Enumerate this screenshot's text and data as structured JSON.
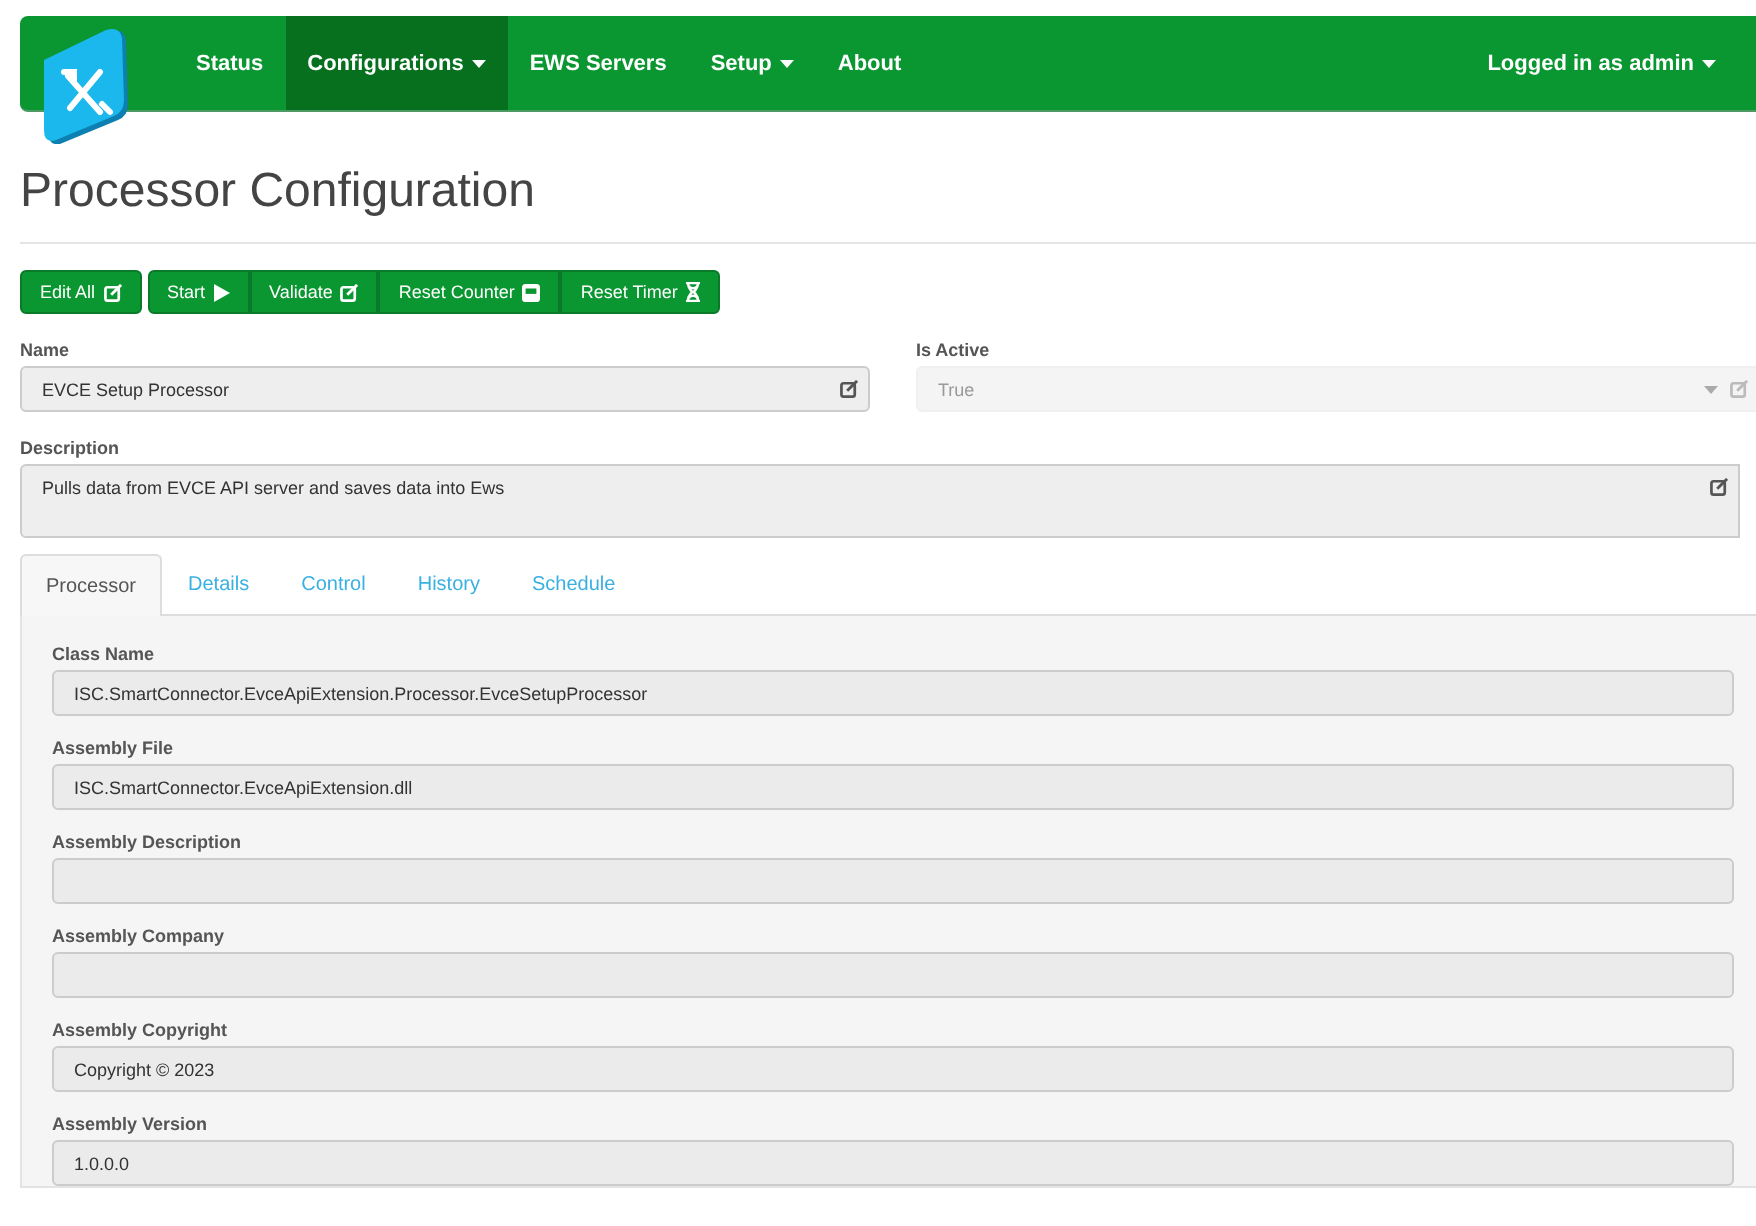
{
  "navbar": {
    "items": [
      {
        "label": "Status",
        "selected": false,
        "dropdown": false
      },
      {
        "label": "Configurations",
        "selected": true,
        "dropdown": true
      },
      {
        "label": "EWS Servers",
        "selected": false,
        "dropdown": false
      },
      {
        "label": "Setup",
        "selected": false,
        "dropdown": true
      },
      {
        "label": "About",
        "selected": false,
        "dropdown": false
      }
    ],
    "user": {
      "label": "Logged in as admin",
      "dropdown": true
    }
  },
  "page_title": "Processor Configuration",
  "toolbar": {
    "groups": [
      [
        {
          "label": "Edit All",
          "kind": "edit"
        }
      ],
      [
        {
          "label": "Start",
          "kind": "play"
        },
        {
          "label": "Validate",
          "kind": "edit"
        },
        {
          "label": "Reset Counter",
          "kind": "counter"
        },
        {
          "label": "Reset Timer",
          "kind": "hourglass"
        }
      ]
    ]
  },
  "name_field": {
    "label": "Name",
    "value": "EVCE Setup Processor"
  },
  "is_active": {
    "label": "Is Active",
    "value": "True",
    "disabled": true
  },
  "description": {
    "label": "Description",
    "value": "Pulls data from EVCE API server and saves data into Ews"
  },
  "tabs": [
    {
      "label": "Processor",
      "selected": true
    },
    {
      "label": "Details",
      "selected": false
    },
    {
      "label": "Control",
      "selected": false
    },
    {
      "label": "History",
      "selected": false
    },
    {
      "label": "Schedule",
      "selected": false
    }
  ],
  "processor_fields": [
    {
      "label": "Class Name",
      "value": "ISC.SmartConnector.EvceApiExtension.Processor.EvceSetupProcessor"
    },
    {
      "label": "Assembly File",
      "value": "ISC.SmartConnector.EvceApiExtension.dll"
    },
    {
      "label": "Assembly Description"
    },
    {
      "label": "Assembly Company"
    },
    {
      "label": "Assembly Copyright",
      "value": "Copyright ©  2023"
    },
    {
      "label": "Assembly Version",
      "value": "1.0.0.0"
    }
  ]
}
